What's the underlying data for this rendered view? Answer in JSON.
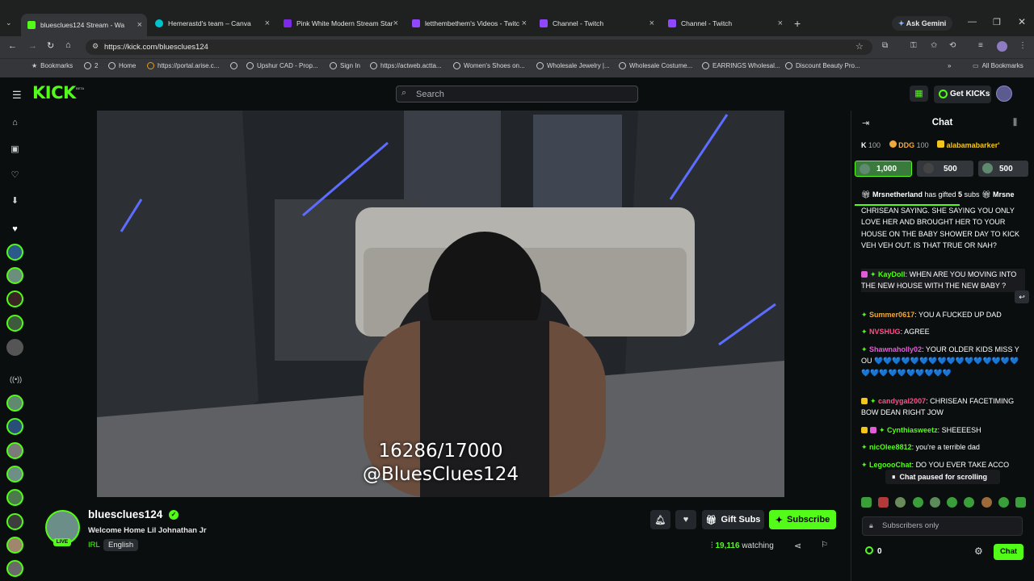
{
  "browser": {
    "tabs": [
      {
        "label": "bluesclues124 Stream - Wa",
        "color": "#53fc18"
      },
      {
        "label": "Hemerastd's team – Canva",
        "color": "#00c4cc"
      },
      {
        "label": "Pink White Modern Stream Star",
        "color": "#7d2ae8"
      },
      {
        "label": "letthembethem's Videos - Twitc",
        "color": "#9146ff"
      },
      {
        "label": "Channel - Twitch",
        "color": "#9146ff"
      },
      {
        "label": "Channel - Twitch",
        "color": "#9146ff"
      }
    ],
    "ask_gemini": "Ask Gemini",
    "url": "https://kick.com/bluesclues124",
    "bookmarks": [
      "Bookmarks",
      "2",
      "Home",
      "https://portal.arise.c...",
      "Upshur CAD - Prop...",
      "Sign In",
      "https://actweb.actta...",
      "Women's Shoes on...",
      "Wholesale Jewelry |...",
      "Wholesale Costume...",
      "EARRINGS Wholesal...",
      "Discount Beauty Pro..."
    ],
    "all_bookmarks": "All Bookmarks"
  },
  "header": {
    "logo": "KICK",
    "logo_tag": "BETA",
    "search_placeholder": "Search",
    "get_kicks": "Get KICKs"
  },
  "video": {
    "overlay_line1": "16286/17000",
    "overlay_line2": "@BluesClues124"
  },
  "streamer": {
    "name": "bluesclues124",
    "live_label": "LIVE",
    "title": "Welcome Home Lil Johnathan Jr",
    "category": "IRL",
    "language": "English",
    "gift_subs": "Gift Subs",
    "subscribe": "Subscribe",
    "viewers": "19,116",
    "watching_label": "watching"
  },
  "chat": {
    "title": "Chat",
    "leaderboard": [
      {
        "name": "K",
        "count": "100"
      },
      {
        "name": "DDG",
        "count": "100"
      },
      {
        "name": "alabamabarker'",
        "count": ""
      }
    ],
    "pinned_gifts": [
      "1,000",
      "500",
      "500"
    ],
    "gift_notice": {
      "user": "Mrsnetherland",
      "text": "has gifted",
      "count": "5",
      "unit": "subs",
      "next_user": "Mrsne"
    },
    "messages": [
      {
        "user": "",
        "text": "CHRISEAN SAYING. SHE SAYING YOU ONLY LOVE HER AND BROUGHT HER TO YOUR HOUSE ON THE BABY SHOWER DAY TO KICK VEH VEH OUT. IS THAT TRUE OR NAH?",
        "color": "#ffffff"
      },
      {
        "user": "KayDoll",
        "text": "WHEN ARE YOU MOVING INTO THE NEW HOUSE WITH THE NEW BABY ?",
        "color": "#53fc18"
      },
      {
        "user": "Summer0617",
        "text": "YOU A FUCKED UP DAD",
        "color": "#f2a93b"
      },
      {
        "user": "NVSHUG",
        "text": "AGREE",
        "color": "#ff4d88"
      },
      {
        "user": "Shawnaholly02",
        "text": "YOUR OLDER KIDS MISS YOU 💙💙💙💙💙💙💙💙💙💙💙💙💙💙💙💙💙💙💙💙💙💙💙💙💙💙",
        "color": "#e35bd9"
      },
      {
        "user": "candygal2007",
        "text": "CHRISEAN FACETIMING BOW DEAN RIGHT JOW",
        "color": "#ff4d88"
      },
      {
        "user": "Cynthiasweetz",
        "text": "SHEEEESH",
        "color": "#53fc18"
      },
      {
        "user": "nicOlee8812",
        "text": "you're a terrible dad",
        "color": "#53fc18"
      },
      {
        "user": "LegoooChat",
        "text": "DO YOU EVER TAKE ACCO",
        "color": "#53fc18"
      }
    ],
    "paused": "Chat paused for scrolling",
    "subscribers_only": "Subscribers only",
    "kicks_count": "0",
    "send_label": "Chat"
  }
}
